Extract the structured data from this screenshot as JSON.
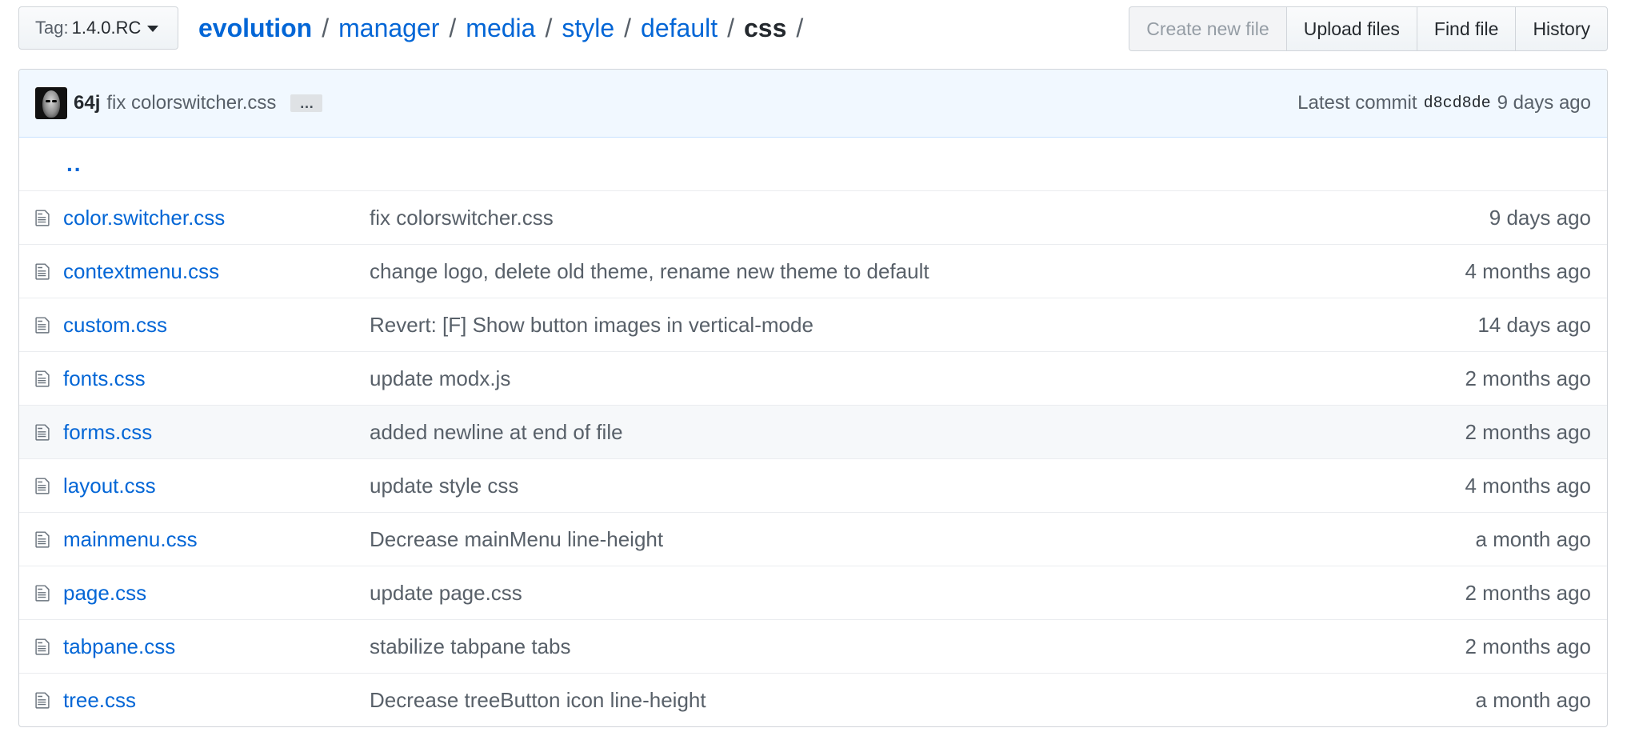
{
  "toolbar": {
    "tag_prefix": "Tag:",
    "tag_value": "1.4.0.RC",
    "buttons": {
      "create_new_file": "Create new file",
      "upload_files": "Upload files",
      "find_file": "Find file",
      "history": "History"
    }
  },
  "breadcrumb": {
    "repo": "evolution",
    "segments": [
      "manager",
      "media",
      "style",
      "default"
    ],
    "current": "css",
    "separator": "/"
  },
  "commit": {
    "author": "64j",
    "message": "fix colorswitcher.css",
    "ellipsis": "…",
    "latest_label": "Latest commit",
    "sha": "d8cd8de",
    "age": "9 days ago"
  },
  "parent_link": "..",
  "files": [
    {
      "name": "color.switcher.css",
      "message": "fix colorswitcher.css",
      "age": "9 days ago"
    },
    {
      "name": "contextmenu.css",
      "message": "change logo, delete old theme, rename new theme to default",
      "age": "4 months ago"
    },
    {
      "name": "custom.css",
      "message": "Revert: [F] Show button images in vertical-mode",
      "age": "14 days ago"
    },
    {
      "name": "fonts.css",
      "message": "update modx.js",
      "age": "2 months ago"
    },
    {
      "name": "forms.css",
      "message": "added newline at end of file",
      "age": "2 months ago"
    },
    {
      "name": "layout.css",
      "message": "update style css",
      "age": "4 months ago"
    },
    {
      "name": "mainmenu.css",
      "message": "Decrease mainMenu line-height",
      "age": "a month ago"
    },
    {
      "name": "page.css",
      "message": "update page.css",
      "age": "2 months ago"
    },
    {
      "name": "tabpane.css",
      "message": "stabilize tabpane tabs",
      "age": "2 months ago"
    },
    {
      "name": "tree.css",
      "message": "Decrease treeButton icon line-height",
      "age": "a month ago"
    }
  ],
  "colors": {
    "link": "#0366d6",
    "muted": "#586069",
    "commit_bar_bg": "#f1f8ff",
    "border": "#d1d5da"
  }
}
